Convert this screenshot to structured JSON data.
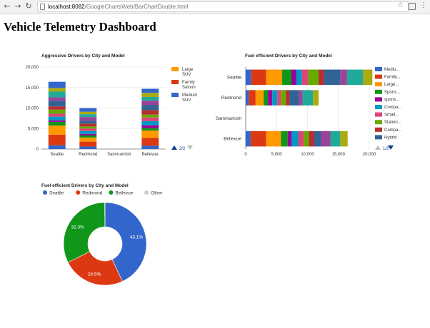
{
  "browser": {
    "url_host": "localhost:8082",
    "url_path": "/GoogleChartsWeb/BarChartDouble.html"
  },
  "page": {
    "title": "Vehicle Telemetry Dashboard"
  },
  "colors": {
    "palette": [
      "#3366cc",
      "#dc3912",
      "#ff9900",
      "#109618",
      "#990099",
      "#0099c6",
      "#dd4477",
      "#66aa00",
      "#b82e2e",
      "#316395",
      "#994499",
      "#22aa99",
      "#aaaa11"
    ]
  },
  "chart_data": [
    {
      "type": "bar",
      "orientation": "vertical",
      "stacked": true,
      "title": "Aggressive Drivers by City and Model",
      "categories": [
        "Seattle",
        "Redmond",
        "Sammamish",
        "Bellevue"
      ],
      "ylim": [
        0,
        20000
      ],
      "yticks": [
        "0",
        "5,000",
        "10,000",
        "15,000",
        "20,000"
      ],
      "grid": true,
      "legend_position": "right",
      "legend": [
        {
          "label": "Large SUV",
          "lines": [
            "Large",
            "SUV"
          ],
          "color": "#ff9900"
        },
        {
          "label": "Family Saloon",
          "lines": [
            "Family",
            "Saloon"
          ],
          "color": "#dc3912"
        },
        {
          "label": "Medium SUV",
          "lines": [
            "Medium",
            "SUV"
          ],
          "color": "#3366cc"
        }
      ],
      "pager": "2/2",
      "segments": {
        "Seattle": [
          900,
          2600,
          2200,
          900,
          400,
          900,
          700,
          1000,
          800,
          1400,
          800,
          1400,
          900,
          1500
        ],
        "Redmond": [
          600,
          1200,
          1000,
          500,
          400,
          700,
          600,
          500,
          700,
          700,
          900,
          700,
          600,
          900
        ],
        "Sammamish": [],
        "Bellevue": [
          800,
          1900,
          1800,
          600,
          700,
          1000,
          900,
          700,
          1100,
          1200,
          1100,
          900,
          1000,
          1000
        ]
      }
    },
    {
      "type": "bar",
      "orientation": "horizontal",
      "stacked": true,
      "title": "Fuel efficient Drivers by City and Model",
      "categories": [
        "Seattle",
        "Redmond",
        "Sammamish",
        "Bellevue"
      ],
      "xlim": [
        0,
        20000
      ],
      "xticks": [
        "0",
        "5,000",
        "10,000",
        "15,000",
        "20,000"
      ],
      "grid": true,
      "legend_position": "right",
      "legend": [
        {
          "label": "Mediu...",
          "color": "#3366cc"
        },
        {
          "label": "Family...",
          "color": "#dc3912"
        },
        {
          "label": "Large...",
          "color": "#ff9900"
        },
        {
          "label": "Sports...",
          "color": "#109618"
        },
        {
          "label": "sports...",
          "color": "#990099"
        },
        {
          "label": "Compa...",
          "color": "#0099c6"
        },
        {
          "label": "Small...",
          "color": "#dd4477"
        },
        {
          "label": "Station...",
          "color": "#66aa00"
        },
        {
          "label": "Compa...",
          "color": "#b82e2e"
        },
        {
          "label": "Hybrid",
          "color": "#316395"
        }
      ],
      "pager": "1/2",
      "segments": {
        "Seattle": [
          900,
          2400,
          2600,
          1500,
          800,
          900,
          1000,
          1700,
          900,
          2600,
          1100,
          2600,
          1500
        ],
        "Redmond": [
          500,
          1100,
          1300,
          700,
          700,
          800,
          600,
          800,
          600,
          1500,
          600,
          1700,
          900
        ],
        "Sammamish": [],
        "Bellevue": [
          800,
          2500,
          2400,
          1100,
          600,
          1100,
          900,
          800,
          900,
          1100,
          1500,
          1600,
          1200
        ]
      }
    },
    {
      "type": "pie",
      "donut": true,
      "title": "Fuel efficient Drivers by City and Model",
      "legend_position": "top",
      "slices": [
        {
          "label": "Seattle",
          "value": 43.1,
          "display": "43.1%",
          "color": "#3366cc"
        },
        {
          "label": "Redmond",
          "value": 24.5,
          "display": "24.5%",
          "color": "#dc3912"
        },
        {
          "label": "Bellevue",
          "value": 32.3,
          "display": "32.3%",
          "color": "#109618"
        },
        {
          "label": "Other",
          "value": 0.1,
          "display": "",
          "color": "#cccccc"
        }
      ]
    }
  ]
}
